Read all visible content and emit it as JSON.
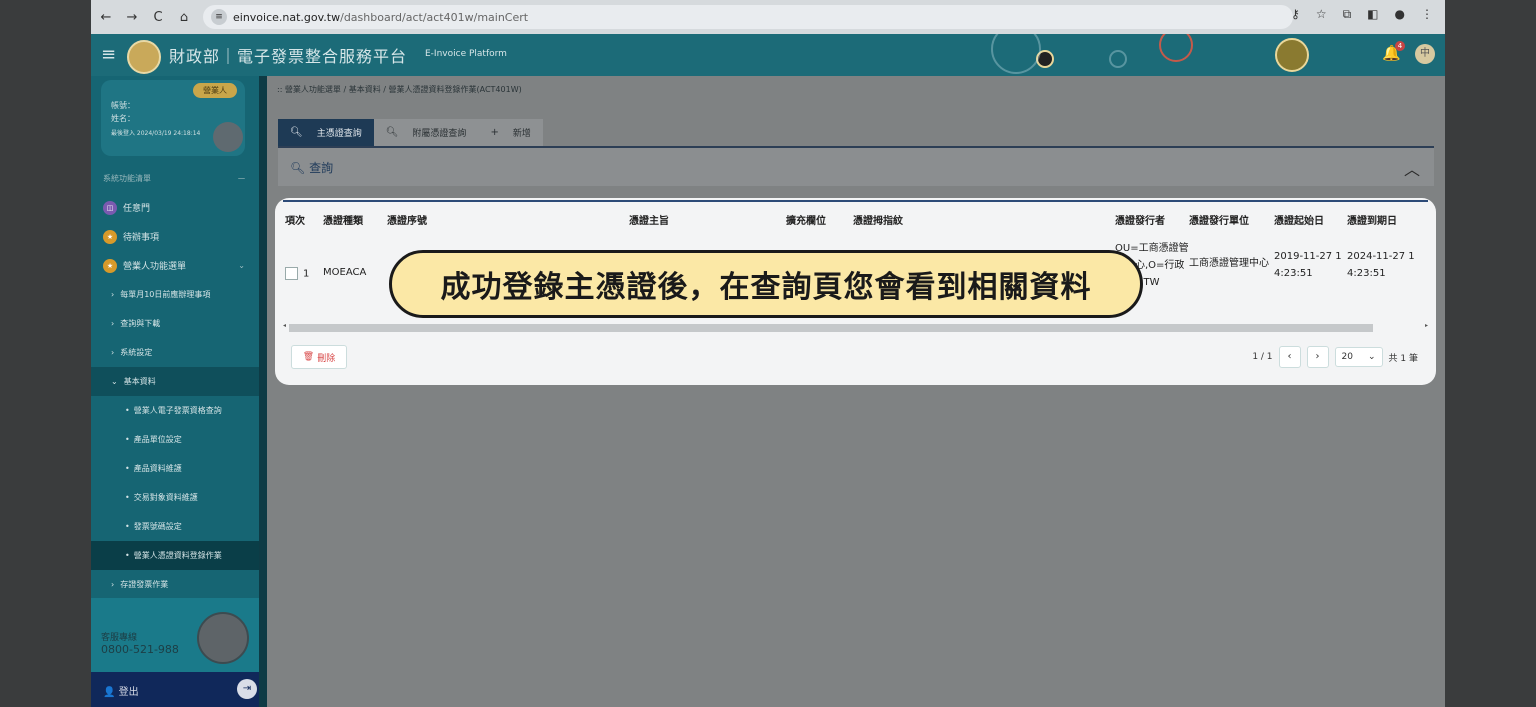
{
  "browser": {
    "url_host": "einvoice.nat.gov.tw",
    "url_path": "/dashboard/act/act401w/mainCert"
  },
  "header": {
    "title": "財政部｜電子發票整合服務平台",
    "subtitle": "E-Invoice Platform",
    "notification_count": "4",
    "user_initial": "中"
  },
  "sidebar": {
    "user_card": {
      "role": "營業人",
      "account_label": "帳號：",
      "name_label": "姓名：",
      "last_login": "最後登入 2024/03/19 24:18:14"
    },
    "section_title": "系統功能清單",
    "section_toggle": "－",
    "items": [
      {
        "label": "任意門",
        "icon": "door-icon"
      },
      {
        "label": "待辦事項",
        "icon": "star-icon"
      },
      {
        "label": "營業人功能選單",
        "icon": "star-icon"
      },
      {
        "label": "每單月10日前應辦理事項"
      },
      {
        "label": "查詢與下載"
      },
      {
        "label": "系統設定"
      },
      {
        "label": "基本資料"
      },
      {
        "label": "營業人電子發票資格查詢"
      },
      {
        "label": "產品單位設定"
      },
      {
        "label": "產品資料維護"
      },
      {
        "label": "交易對象資料維護"
      },
      {
        "label": "發票號碼設定"
      },
      {
        "label": "營業人憑證資料登錄作業"
      },
      {
        "label": "存證發票作業"
      }
    ],
    "support_label": "客服專線",
    "support_phone": "0800-521-988",
    "logout_label": "登出"
  },
  "breadcrumb": ":: 營業人功能選單 / 基本資料 / 營業人憑證資料登錄作業(ACT401W)",
  "tabs": [
    {
      "label": "主憑證查詢",
      "icon": "search-icon",
      "glyph": "🔍"
    },
    {
      "label": "附屬憑證查詢",
      "icon": "search-icon",
      "glyph": "🔍"
    },
    {
      "label": "新增",
      "icon": "plus-icon",
      "glyph": "+"
    }
  ],
  "query": {
    "title": "查詢"
  },
  "table": {
    "headers": [
      "項次",
      "憑證種類",
      "憑證序號",
      "憑證主旨",
      "擴充欄位",
      "憑證拇指紋",
      "憑證發行者",
      "憑證發行單位",
      "憑證起始日",
      "憑證到期日"
    ],
    "rows": [
      {
        "index": "1",
        "type": "MOEACA",
        "serial": "",
        "subject": "",
        "ext": "",
        "thumbprint": "",
        "issuer": "OU=工商憑證管理中心,O=行政院,C=TW",
        "issuer_unit": "工商憑證管理中心",
        "start": "2019-11-27 14:23:51",
        "end": "2024-11-27 14:23:51"
      }
    ]
  },
  "actions": {
    "delete_label": "刪除"
  },
  "pager": {
    "page_info": "1 / 1",
    "page_size": "20",
    "total": "共 1 筆"
  },
  "caption": "成功登錄主憑證後，在查詢頁您會看到相關資料",
  "colors": {
    "header": "#1c6b78",
    "sidebar": "#166573",
    "active_tab": "#1e3a55",
    "caption_bg": "#fbe8a6"
  }
}
